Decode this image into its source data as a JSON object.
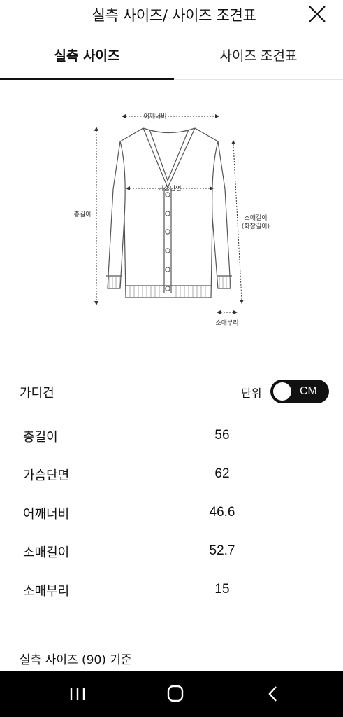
{
  "header": {
    "title": "실측 사이즈/ 사이즈 조견표"
  },
  "tabs": [
    {
      "label": "실측 사이즈"
    },
    {
      "label": "사이즈 조견표"
    }
  ],
  "diagram": {
    "shoulder": "어깨너비",
    "chest": "가슴단면",
    "total_length": "총길이",
    "sleeve_length": "소매길이",
    "sleeve_length_alt": "(화장길이)",
    "cuff": "소매부리"
  },
  "product": {
    "name": "가디건",
    "unit_label": "단위",
    "unit_value": "CM"
  },
  "measurements": [
    {
      "label": "총길이",
      "value": "56"
    },
    {
      "label": "가슴단면",
      "value": "62"
    },
    {
      "label": "어깨너비",
      "value": "46.6"
    },
    {
      "label": "소매길이",
      "value": "52.7"
    },
    {
      "label": "소매부리",
      "value": "15"
    }
  ],
  "footnote": "실측 사이즈 (90) 기준"
}
